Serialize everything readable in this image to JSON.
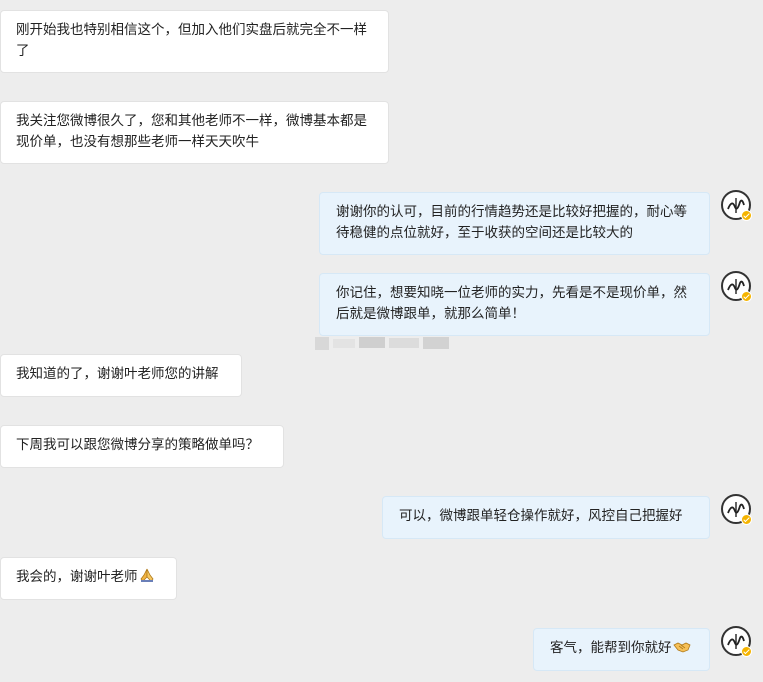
{
  "messages": [
    {
      "side": "in",
      "text": "刚开始我也特别相信这个，但加入他们实盘后就完全不一样了"
    },
    {
      "side": "in",
      "text": "我关注您微博很久了，您和其他老师不一样，微博基本都是现价单，也没有想那些老师一样天天吹牛"
    },
    {
      "side": "out",
      "text": "谢谢你的认可，目前的行情趋势还是比较好把握的，耐心等待稳健的点位就好，至于收获的空间还是比较大的"
    },
    {
      "side": "out",
      "text": "你记住，想要知晓一位老师的实力，先看是不是现价单，然后就是微博跟单，就那么简单！"
    },
    {
      "side": "in",
      "text": "我知道的了，谢谢叶老师您的讲解"
    },
    {
      "side": "in",
      "text": "下周我可以跟您微博分享的策略做单吗？"
    },
    {
      "side": "out",
      "text": "可以，微博跟单轻仓操作就好，风控自己把握好"
    },
    {
      "side": "in",
      "text": "我会的，谢谢叶老师",
      "emoji": "folded-hands-icon"
    },
    {
      "side": "out",
      "text": "客气，能帮到你就好",
      "emoji": "handshake-icon"
    }
  ],
  "colors": {
    "background": "#ededed",
    "incoming_bubble": "#ffffff",
    "outgoing_bubble": "#e8f3fc",
    "verified_badge": "#f5b400"
  },
  "avatar": {
    "icon": "teacher-avatar-icon",
    "verified": true
  }
}
